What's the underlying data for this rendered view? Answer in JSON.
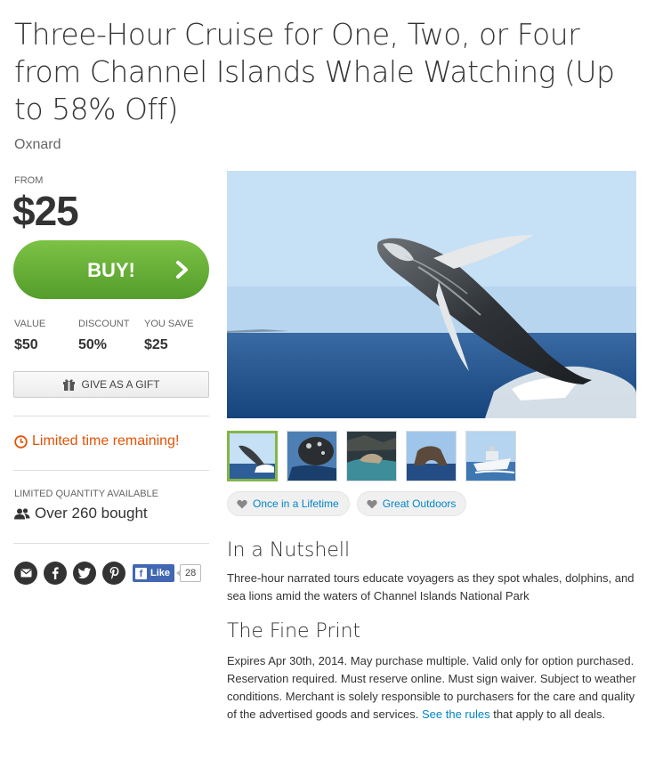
{
  "deal": {
    "title": "Three-Hour Cruise for One, Two, or Four from Channel Islands Whale Watching (Up to 58% Off)",
    "location": "Oxnard"
  },
  "pricing": {
    "from_label": "FROM",
    "price": "$25",
    "buy_label": "BUY!",
    "stats": [
      {
        "label": "VALUE",
        "value": "$50"
      },
      {
        "label": "DISCOUNT",
        "value": "50%"
      },
      {
        "label": "YOU SAVE",
        "value": "$25"
      }
    ],
    "gift_label": "GIVE AS A GIFT"
  },
  "status": {
    "limited_time": "Limited time remaining!",
    "quantity_label": "LIMITED QUANTITY AVAILABLE",
    "bought": "Over 260 bought"
  },
  "social": {
    "fb_like_label": "Like",
    "fb_count": "28",
    "icons": [
      "email-icon",
      "facebook-icon",
      "twitter-icon",
      "pinterest-icon"
    ]
  },
  "gallery": {
    "thumbnail_count": 5,
    "tags": [
      "Once in a Lifetime",
      "Great Outdoors"
    ]
  },
  "nutshell": {
    "heading": "In a Nutshell",
    "text": "Three-hour narrated tours educate voyagers as they spot whales, dolphins, and sea lions amid the waters of Channel Islands National Park"
  },
  "fine_print": {
    "heading": "The Fine Print",
    "text": "Expires Apr 30th, 2014. May purchase multiple. Valid only for option purchased. Reservation required. Must reserve online. Must sign waiver. Subject to weather conditions. Merchant is solely responsible to purchasers for the care and quality of the advertised goods and services.",
    "link_text": "See the rules",
    "suffix": "that apply to all deals."
  },
  "colors": {
    "buy_green": "#6bb23a",
    "warning_orange": "#e35205",
    "link_blue": "#0185c6"
  }
}
